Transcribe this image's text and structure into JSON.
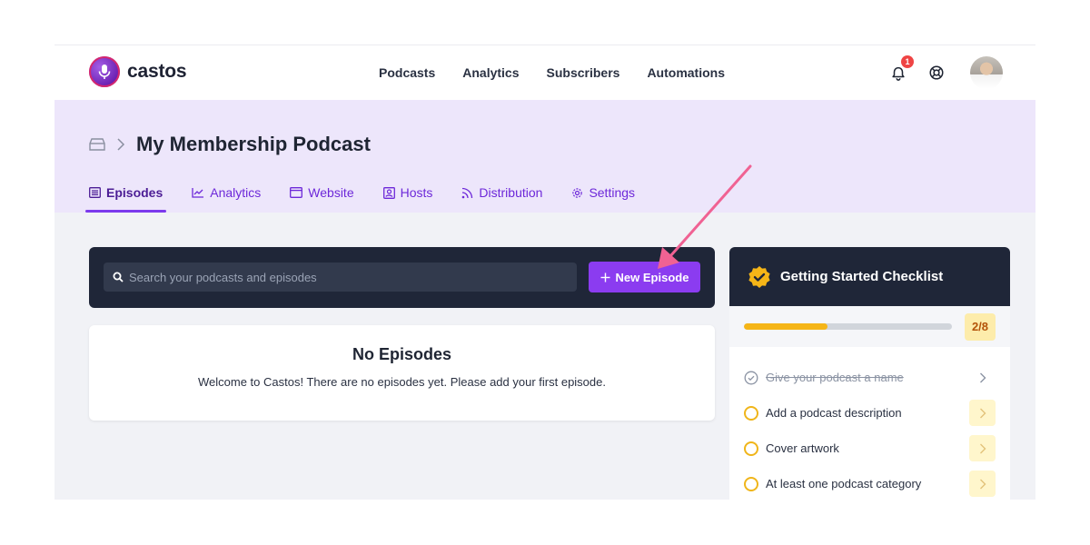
{
  "brand": {
    "name": "castos",
    "accent": "#8b3cf0"
  },
  "nav": {
    "links": [
      "Podcasts",
      "Analytics",
      "Subscribers",
      "Automations"
    ],
    "notification_count": "1"
  },
  "page": {
    "title": "My Membership Podcast",
    "tabs": [
      {
        "label": "Episodes",
        "icon": "list-icon"
      },
      {
        "label": "Analytics",
        "icon": "chart-icon"
      },
      {
        "label": "Website",
        "icon": "browser-icon"
      },
      {
        "label": "Hosts",
        "icon": "person-badge-icon"
      },
      {
        "label": "Distribution",
        "icon": "rss-icon"
      },
      {
        "label": "Settings",
        "icon": "gear-icon"
      }
    ]
  },
  "search": {
    "placeholder": "Search your podcasts and episodes"
  },
  "new_episode": {
    "label": "New Episode"
  },
  "empty_state": {
    "title": "No Episodes",
    "message": "Welcome to Castos! There are no episodes yet. Please add your first episode."
  },
  "checklist": {
    "title": "Getting Started Checklist",
    "progress_label": "2/8",
    "progress_fraction": 0.4,
    "items": [
      {
        "label": "Give your podcast a name",
        "done": true
      },
      {
        "label": "Add a podcast description",
        "done": false
      },
      {
        "label": "Cover artwork",
        "done": false
      },
      {
        "label": "At least one podcast category",
        "done": false
      }
    ]
  }
}
